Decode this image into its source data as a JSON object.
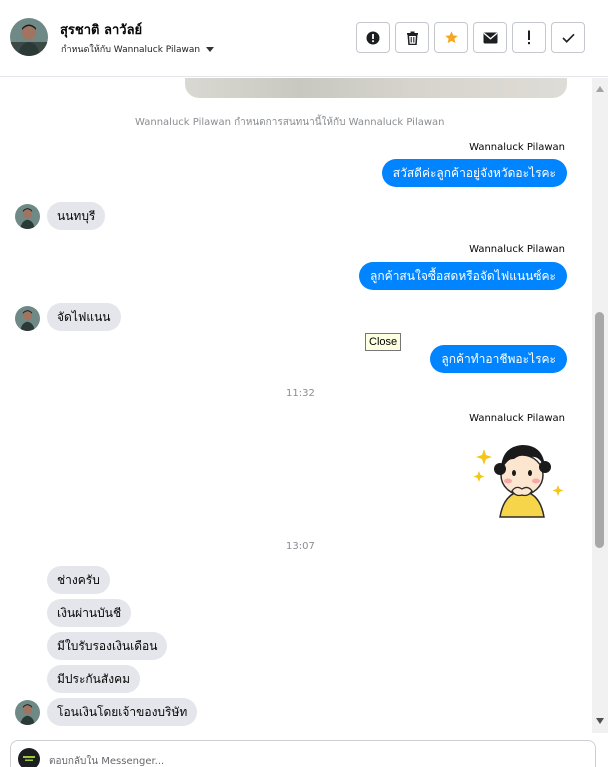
{
  "header": {
    "contact_name": "สุรชาติ ลาวัลย์",
    "assigned_text": "กำหนดให้กับ Wannaluck Pilawan",
    "actions": [
      {
        "name": "report-icon",
        "color": "#1c1e21"
      },
      {
        "name": "trash-icon",
        "color": "#1c1e21"
      },
      {
        "name": "star-icon",
        "color": "#f5a623"
      },
      {
        "name": "envelope-icon",
        "color": "#1c1e21"
      },
      {
        "name": "exclamation-icon",
        "color": "#1c1e21"
      },
      {
        "name": "check-icon",
        "color": "#1c1e21"
      }
    ]
  },
  "conversation": {
    "system_message": "Wannaluck Pilawan กำหนดการสนทนานี้ให้กับ Wannaluck Pilawan",
    "agent_name": "Wannaluck Pilawan",
    "messages": [
      {
        "dir": "out",
        "text": "สวัสดีค่ะลูกค้าอยู่จังหวัดอะไรคะ"
      },
      {
        "dir": "in",
        "text": "นนทบุรี"
      },
      {
        "dir": "out",
        "text": "ลูกค้าสนใจซื้อสดหรือจัดไฟแนนซ์คะ"
      },
      {
        "dir": "in",
        "text": "จัดไฟแนน"
      },
      {
        "dir": "out",
        "text": "ลูกค้าทำอาชีพอะไรคะ"
      },
      {
        "dir": "in",
        "text": "ช่างครับ"
      },
      {
        "dir": "in",
        "text": "เงินผ่านบันชี"
      },
      {
        "dir": "in",
        "text": "มีใบรับรองเงินเดือน"
      },
      {
        "dir": "in",
        "text": "มีประกันสังคม"
      },
      {
        "dir": "in",
        "text": "โอนเงินโดยเจ้าของบริษัท"
      }
    ],
    "timestamps": [
      "11:32",
      "13:07"
    ],
    "tooltip": "Close",
    "sticker": "girl-sticker-icon"
  },
  "composer": {
    "placeholder": "ตอบกลับใน Messenger..."
  },
  "colors": {
    "outgoing_bubble": "#0084ff",
    "incoming_bubble": "#e4e6eb",
    "star_accent": "#f5a623"
  }
}
